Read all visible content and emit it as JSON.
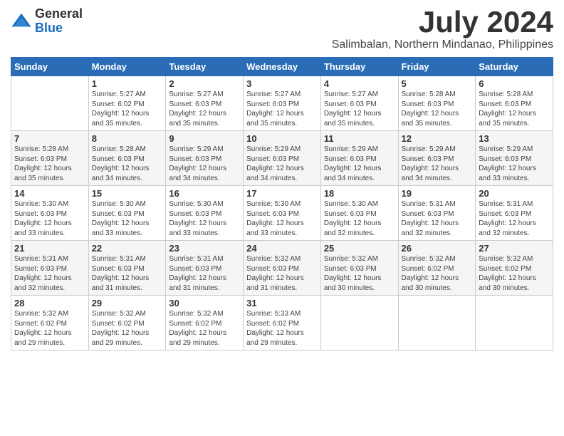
{
  "logo": {
    "general": "General",
    "blue": "Blue"
  },
  "title": {
    "month": "July 2024",
    "location": "Salimbalan, Northern Mindanao, Philippines"
  },
  "headers": [
    "Sunday",
    "Monday",
    "Tuesday",
    "Wednesday",
    "Thursday",
    "Friday",
    "Saturday"
  ],
  "weeks": [
    [
      {
        "day": "",
        "info": ""
      },
      {
        "day": "1",
        "info": "Sunrise: 5:27 AM\nSunset: 6:02 PM\nDaylight: 12 hours\nand 35 minutes."
      },
      {
        "day": "2",
        "info": "Sunrise: 5:27 AM\nSunset: 6:03 PM\nDaylight: 12 hours\nand 35 minutes."
      },
      {
        "day": "3",
        "info": "Sunrise: 5:27 AM\nSunset: 6:03 PM\nDaylight: 12 hours\nand 35 minutes."
      },
      {
        "day": "4",
        "info": "Sunrise: 5:27 AM\nSunset: 6:03 PM\nDaylight: 12 hours\nand 35 minutes."
      },
      {
        "day": "5",
        "info": "Sunrise: 5:28 AM\nSunset: 6:03 PM\nDaylight: 12 hours\nand 35 minutes."
      },
      {
        "day": "6",
        "info": "Sunrise: 5:28 AM\nSunset: 6:03 PM\nDaylight: 12 hours\nand 35 minutes."
      }
    ],
    [
      {
        "day": "7",
        "info": "Sunrise: 5:28 AM\nSunset: 6:03 PM\nDaylight: 12 hours\nand 35 minutes."
      },
      {
        "day": "8",
        "info": "Sunrise: 5:28 AM\nSunset: 6:03 PM\nDaylight: 12 hours\nand 34 minutes."
      },
      {
        "day": "9",
        "info": "Sunrise: 5:29 AM\nSunset: 6:03 PM\nDaylight: 12 hours\nand 34 minutes."
      },
      {
        "day": "10",
        "info": "Sunrise: 5:29 AM\nSunset: 6:03 PM\nDaylight: 12 hours\nand 34 minutes."
      },
      {
        "day": "11",
        "info": "Sunrise: 5:29 AM\nSunset: 6:03 PM\nDaylight: 12 hours\nand 34 minutes."
      },
      {
        "day": "12",
        "info": "Sunrise: 5:29 AM\nSunset: 6:03 PM\nDaylight: 12 hours\nand 34 minutes."
      },
      {
        "day": "13",
        "info": "Sunrise: 5:29 AM\nSunset: 6:03 PM\nDaylight: 12 hours\nand 33 minutes."
      }
    ],
    [
      {
        "day": "14",
        "info": "Sunrise: 5:30 AM\nSunset: 6:03 PM\nDaylight: 12 hours\nand 33 minutes."
      },
      {
        "day": "15",
        "info": "Sunrise: 5:30 AM\nSunset: 6:03 PM\nDaylight: 12 hours\nand 33 minutes."
      },
      {
        "day": "16",
        "info": "Sunrise: 5:30 AM\nSunset: 6:03 PM\nDaylight: 12 hours\nand 33 minutes."
      },
      {
        "day": "17",
        "info": "Sunrise: 5:30 AM\nSunset: 6:03 PM\nDaylight: 12 hours\nand 33 minutes."
      },
      {
        "day": "18",
        "info": "Sunrise: 5:30 AM\nSunset: 6:03 PM\nDaylight: 12 hours\nand 32 minutes."
      },
      {
        "day": "19",
        "info": "Sunrise: 5:31 AM\nSunset: 6:03 PM\nDaylight: 12 hours\nand 32 minutes."
      },
      {
        "day": "20",
        "info": "Sunrise: 5:31 AM\nSunset: 6:03 PM\nDaylight: 12 hours\nand 32 minutes."
      }
    ],
    [
      {
        "day": "21",
        "info": "Sunrise: 5:31 AM\nSunset: 6:03 PM\nDaylight: 12 hours\nand 32 minutes."
      },
      {
        "day": "22",
        "info": "Sunrise: 5:31 AM\nSunset: 6:03 PM\nDaylight: 12 hours\nand 31 minutes."
      },
      {
        "day": "23",
        "info": "Sunrise: 5:31 AM\nSunset: 6:03 PM\nDaylight: 12 hours\nand 31 minutes."
      },
      {
        "day": "24",
        "info": "Sunrise: 5:32 AM\nSunset: 6:03 PM\nDaylight: 12 hours\nand 31 minutes."
      },
      {
        "day": "25",
        "info": "Sunrise: 5:32 AM\nSunset: 6:03 PM\nDaylight: 12 hours\nand 30 minutes."
      },
      {
        "day": "26",
        "info": "Sunrise: 5:32 AM\nSunset: 6:02 PM\nDaylight: 12 hours\nand 30 minutes."
      },
      {
        "day": "27",
        "info": "Sunrise: 5:32 AM\nSunset: 6:02 PM\nDaylight: 12 hours\nand 30 minutes."
      }
    ],
    [
      {
        "day": "28",
        "info": "Sunrise: 5:32 AM\nSunset: 6:02 PM\nDaylight: 12 hours\nand 29 minutes."
      },
      {
        "day": "29",
        "info": "Sunrise: 5:32 AM\nSunset: 6:02 PM\nDaylight: 12 hours\nand 29 minutes."
      },
      {
        "day": "30",
        "info": "Sunrise: 5:32 AM\nSunset: 6:02 PM\nDaylight: 12 hours\nand 29 minutes."
      },
      {
        "day": "31",
        "info": "Sunrise: 5:33 AM\nSunset: 6:02 PM\nDaylight: 12 hours\nand 29 minutes."
      },
      {
        "day": "",
        "info": ""
      },
      {
        "day": "",
        "info": ""
      },
      {
        "day": "",
        "info": ""
      }
    ]
  ]
}
